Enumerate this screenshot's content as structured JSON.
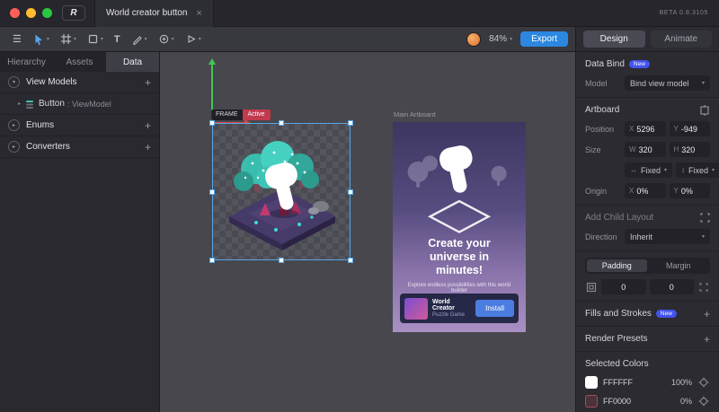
{
  "theme": {
    "accent_blue": "#58A6E6",
    "export_blue": "#2B87E0",
    "badge_blue": "#4353F0",
    "active_red": "#C23A4E",
    "tree_teal": "#3FC3B2",
    "canvas_bg": "#47474D"
  },
  "glyphs": {
    "hamburger": "☰",
    "chevron_down": "▾",
    "chevron_right": "▸",
    "plus": "+",
    "close": "×",
    "text_tool": "T",
    "h_arrows": "↔",
    "v_arrows": "↕",
    "logo": "R"
  },
  "titlebar": {
    "tab_title": "World creator button",
    "beta_version": "BETA 0.8.3105"
  },
  "toolbar": {
    "zoom_level": "84%",
    "export_label": "Export",
    "design_label": "Design",
    "animate_label": "Animate"
  },
  "sidebar": {
    "tabs": [
      {
        "label": "Hierarchy"
      },
      {
        "label": "Assets"
      },
      {
        "label": "Data"
      }
    ],
    "view_models_label": "View Models",
    "button_item_label": "Button",
    "button_item_type": ": ViewModel",
    "enums_label": "Enums",
    "converters_label": "Converters"
  },
  "canvas": {
    "frame_badge": "FRAME",
    "frame_state": "Active",
    "main_artboard_label": "Main Artboard",
    "promo": {
      "headline": "Create your universe in minutes!",
      "subtext": "Explore endless possibilities with this world builder",
      "game_title": "World Creator",
      "game_subtitle": "Puzzle Game",
      "install_label": "Install"
    }
  },
  "inspector": {
    "data_bind_title": "Data Bind",
    "new_badge": "New",
    "model_label": "Model",
    "model_value": "Bind view model",
    "artboard_title": "Artboard",
    "position_label": "Position",
    "position_x_key": "X",
    "position_x": "5296",
    "position_y_key": "Y",
    "position_y": "-949",
    "size_label": "Size",
    "size_w_key": "W",
    "size_w": "320",
    "size_h_key": "H",
    "size_h": "320",
    "width_mode": "Fixed",
    "height_mode": "Fixed",
    "origin_label": "Origin",
    "origin_x_key": "X",
    "origin_x": "0%",
    "origin_y_key": "Y",
    "origin_y": "0%",
    "add_child_layout_label": "Add Child Layout",
    "direction_label": "Direction",
    "direction_value": "Inherit",
    "padding_tab": "Padding",
    "margin_tab": "Margin",
    "padding_value_1": "0",
    "padding_value_2": "0",
    "fills_title": "Fills and Strokes",
    "render_presets_title": "Render Presets",
    "selected_colors_title": "Selected Colors",
    "colors": [
      {
        "hex": "FFFFFF",
        "opacity": "100%",
        "swatch_style": "background:#ffffff"
      },
      {
        "hex": "FF0000",
        "opacity": "0%",
        "swatch_style": "background:#4a3238;border:1px solid #a84a54"
      }
    ]
  }
}
